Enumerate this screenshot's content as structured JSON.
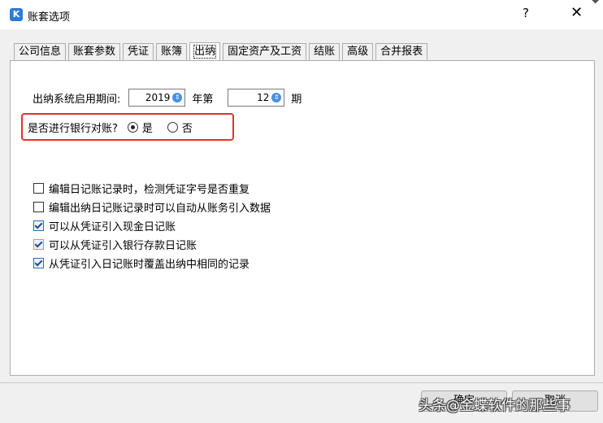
{
  "window": {
    "title": "账套选项",
    "help_label": "?",
    "close_label": "✕",
    "corner_glyph": "◆"
  },
  "tabs": [
    {
      "label": "公司信息"
    },
    {
      "label": "账套参数"
    },
    {
      "label": "凭证"
    },
    {
      "label": "账簿"
    },
    {
      "label": "出纳",
      "active": true
    },
    {
      "label": "固定资产及工资"
    },
    {
      "label": "结账"
    },
    {
      "label": "高级"
    },
    {
      "label": "合并报表"
    }
  ],
  "period": {
    "label": "出纳系统启用期间:",
    "year_value": "2019",
    "year_suffix": "年第",
    "period_value": "12",
    "period_suffix": "期"
  },
  "bank_reconcile": {
    "label": "是否进行银行对账?",
    "yes_label": "是",
    "no_label": "否",
    "selected": "yes"
  },
  "options": [
    {
      "label": "编辑日记账记录时，检测凭证字号是否重复",
      "checked": false
    },
    {
      "label": "编辑出纳日记账记录时可以自动从账务引入数据",
      "checked": false
    },
    {
      "label": "可以从凭证引入现金日记账",
      "checked": true
    },
    {
      "label": "可以从凭证引入银行存款日记账",
      "checked": true
    },
    {
      "label": "从凭证引入日记账时覆盖出纳中相同的记录",
      "checked": true
    }
  ],
  "buttons": {
    "ok_label": "确定",
    "cancel_label": "取消"
  },
  "watermark": "头条@金蝶软件的那些事",
  "colors": {
    "highlight": "#e53030",
    "spin_accent": "#4a90e2",
    "dialog_bg": "#f0f0f0"
  }
}
